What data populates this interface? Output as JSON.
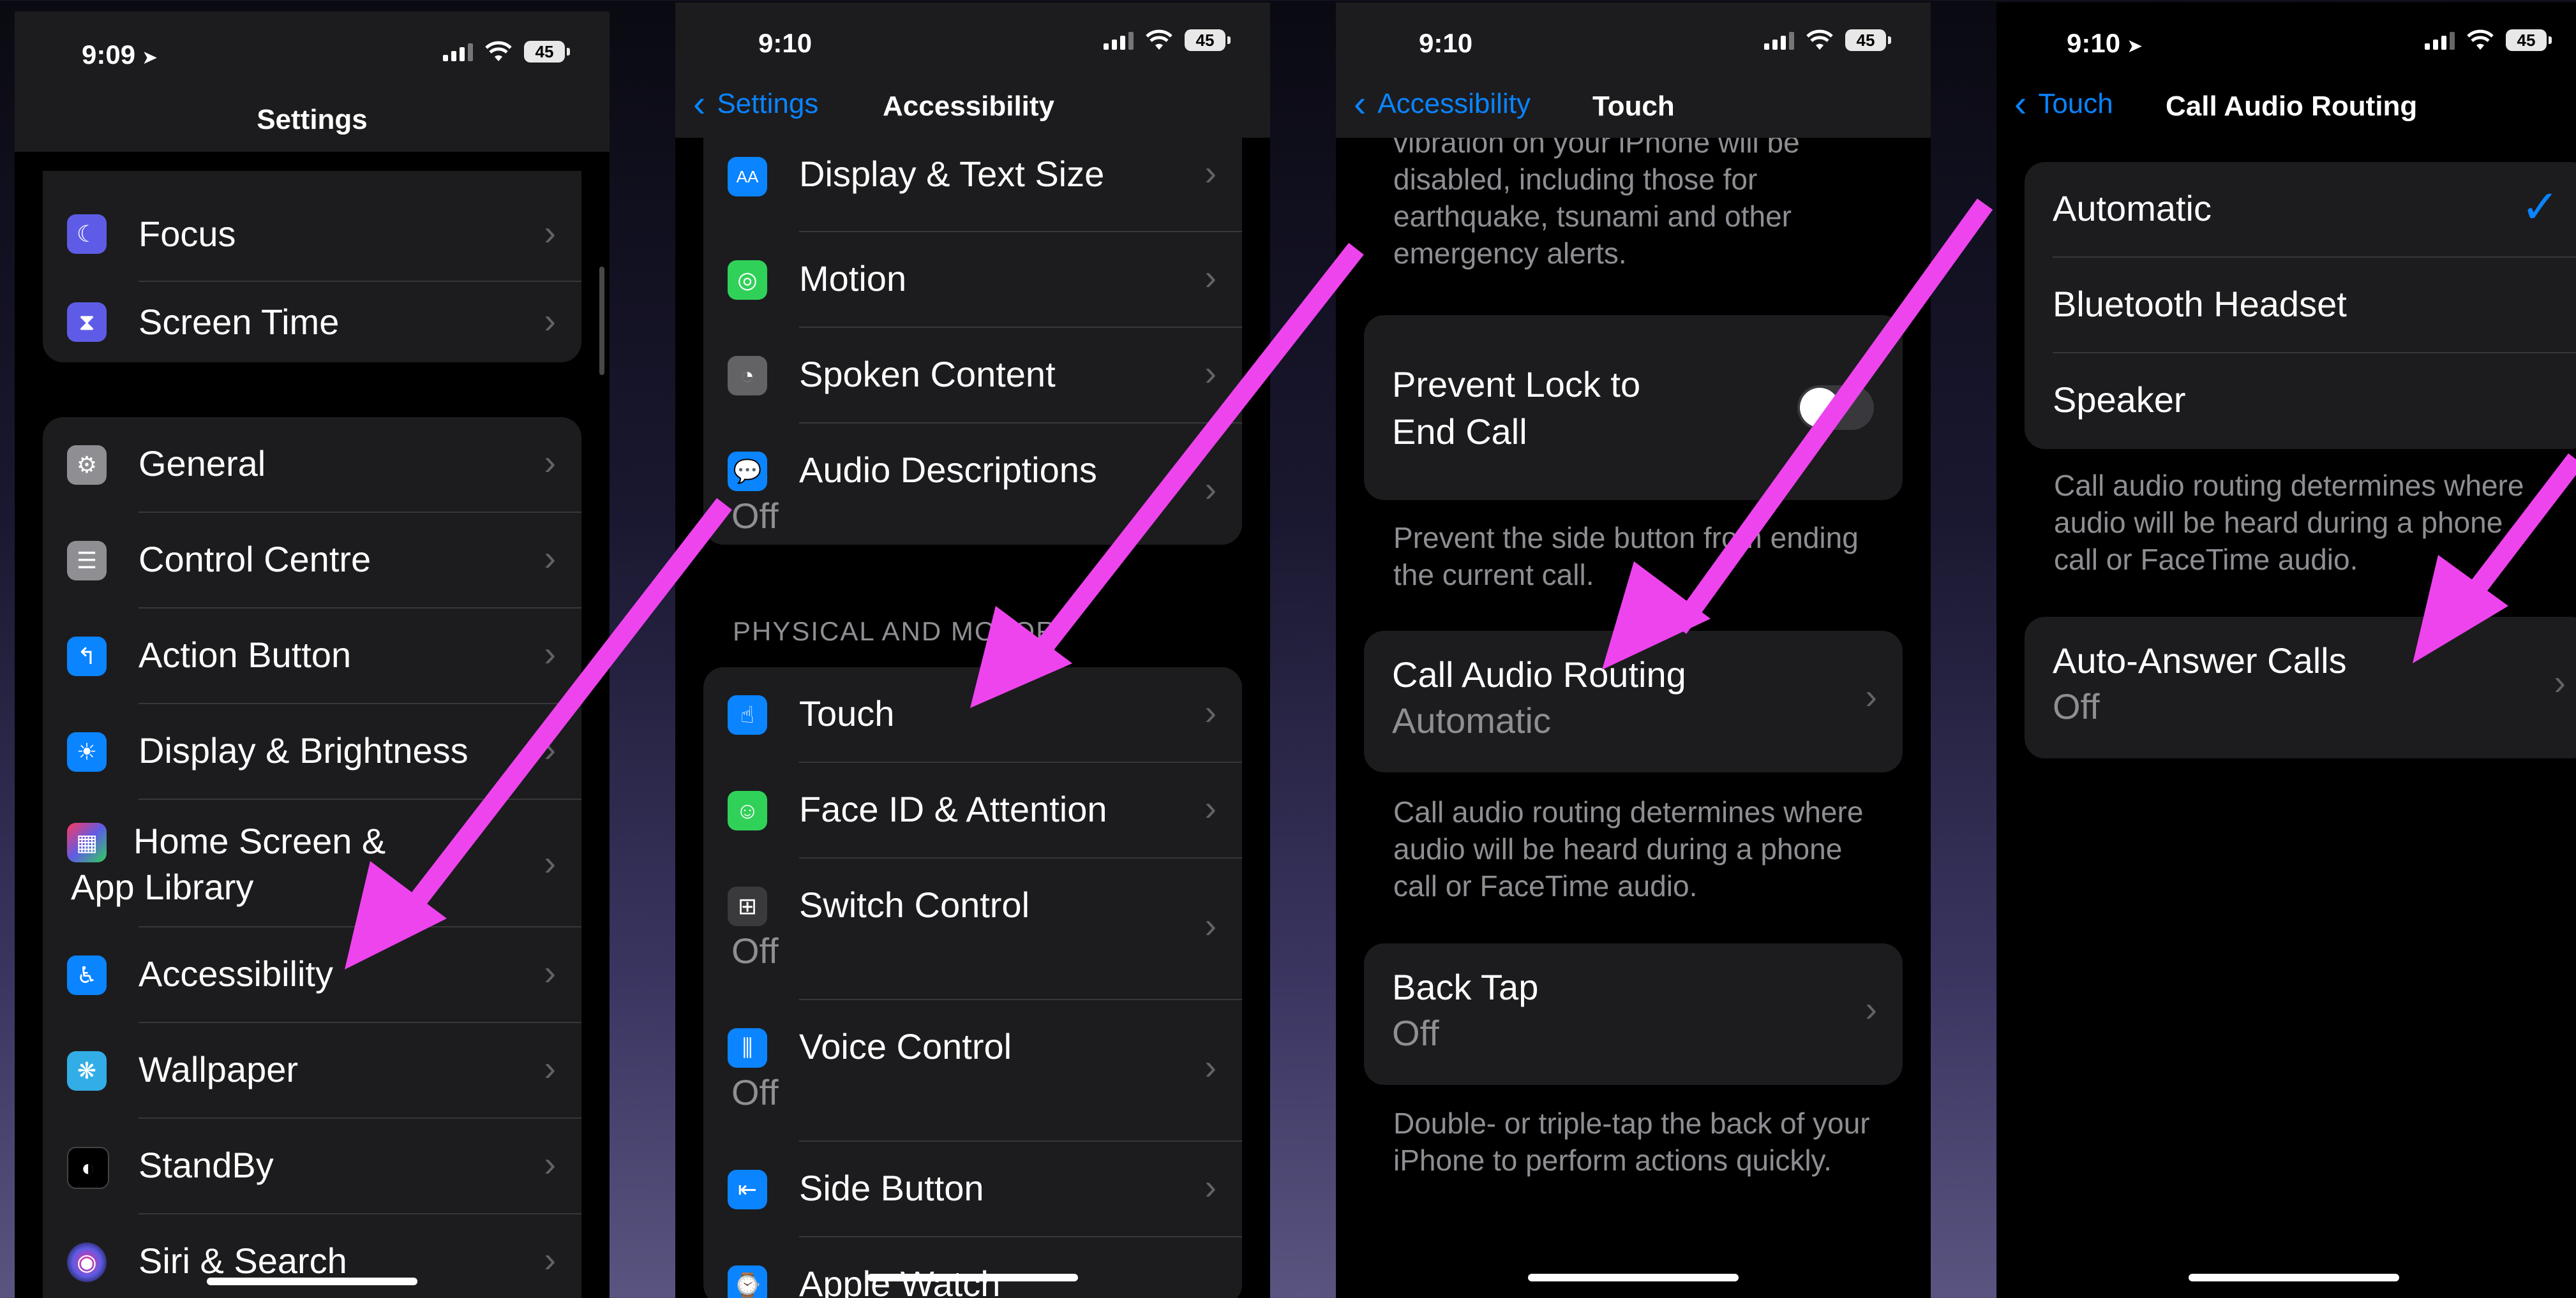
{
  "colors": {
    "accent": "#0a84ff",
    "annotation_arrow": "#ee44ee",
    "group_bg": "#1c1c1e",
    "secondary_text": "#8e8e93"
  },
  "panel1": {
    "time": "9:09",
    "battery": "45",
    "title": "Settings",
    "items": [
      {
        "label": "Focus",
        "icon": "moon-icon"
      },
      {
        "label": "Screen Time",
        "icon": "hourglass-icon"
      },
      {
        "label": "General",
        "icon": "gear-icon"
      },
      {
        "label": "Control Centre",
        "icon": "toggles-icon"
      },
      {
        "label": "Action Button",
        "icon": "action-button-icon"
      },
      {
        "label": "Display & Brightness",
        "icon": "sun-icon"
      },
      {
        "label": "Home Screen &",
        "label2": "App Library",
        "icon": "home-grid-icon"
      },
      {
        "label": "Accessibility",
        "icon": "accessibility-icon"
      },
      {
        "label": "Wallpaper",
        "icon": "wallpaper-flower-icon"
      },
      {
        "label": "StandBy",
        "icon": "standby-icon"
      },
      {
        "label": "Siri & Search",
        "icon": "siri-icon"
      }
    ]
  },
  "panel2": {
    "time": "9:10",
    "battery": "45",
    "back_label": "Settings",
    "title": "Accessibility",
    "vision_items": [
      {
        "label": "Display & Text Size",
        "icon": "text-size-icon"
      },
      {
        "label": "Motion",
        "icon": "motion-icon"
      },
      {
        "label": "Spoken Content",
        "icon": "spoken-content-icon"
      },
      {
        "label": "Audio Descriptions",
        "sub": "Off",
        "icon": "audio-descriptions-icon"
      }
    ],
    "section_header": "PHYSICAL AND MOTOR",
    "motor_items": [
      {
        "label": "Touch",
        "icon": "hand-pointer-icon"
      },
      {
        "label": "Face ID & Attention",
        "icon": "face-id-icon"
      },
      {
        "label": "Switch Control",
        "sub": "Off",
        "icon": "switch-control-icon"
      },
      {
        "label": "Voice Control",
        "sub": "Off",
        "icon": "voice-control-icon"
      },
      {
        "label": "Side Button",
        "icon": "side-button-icon"
      },
      {
        "label": "Apple Watch",
        "icon": "apple-watch-icon"
      }
    ]
  },
  "panel3": {
    "time": "9:10",
    "battery": "45",
    "back_label": "Accessibility",
    "title": "Touch",
    "top_text": "vibration on your iPhone will be disabled, including those for earthquake, tsunami and other emergency alerts.",
    "prevent_lock": {
      "line1": "Prevent Lock to",
      "line2": "End Call"
    },
    "prevent_footer": "Prevent the side button from ending the current call.",
    "call_audio": {
      "label": "Call Audio Routing",
      "value": "Automatic"
    },
    "call_audio_footer": "Call audio routing determines where audio will be heard during a phone call or FaceTime audio.",
    "back_tap": {
      "label": "Back Tap",
      "value": "Off"
    },
    "back_tap_footer": "Double- or triple-tap the back of your iPhone to perform actions quickly."
  },
  "panel4": {
    "time": "9:10",
    "battery": "45",
    "back_label": "Touch",
    "title": "Call Audio Routing",
    "options": [
      "Automatic",
      "Bluetooth Headset",
      "Speaker"
    ],
    "selected": "Automatic",
    "footer": "Call audio routing determines where audio will be heard during a phone call or FaceTime audio.",
    "auto_answer": {
      "label": "Auto-Answer Calls",
      "value": "Off"
    }
  }
}
